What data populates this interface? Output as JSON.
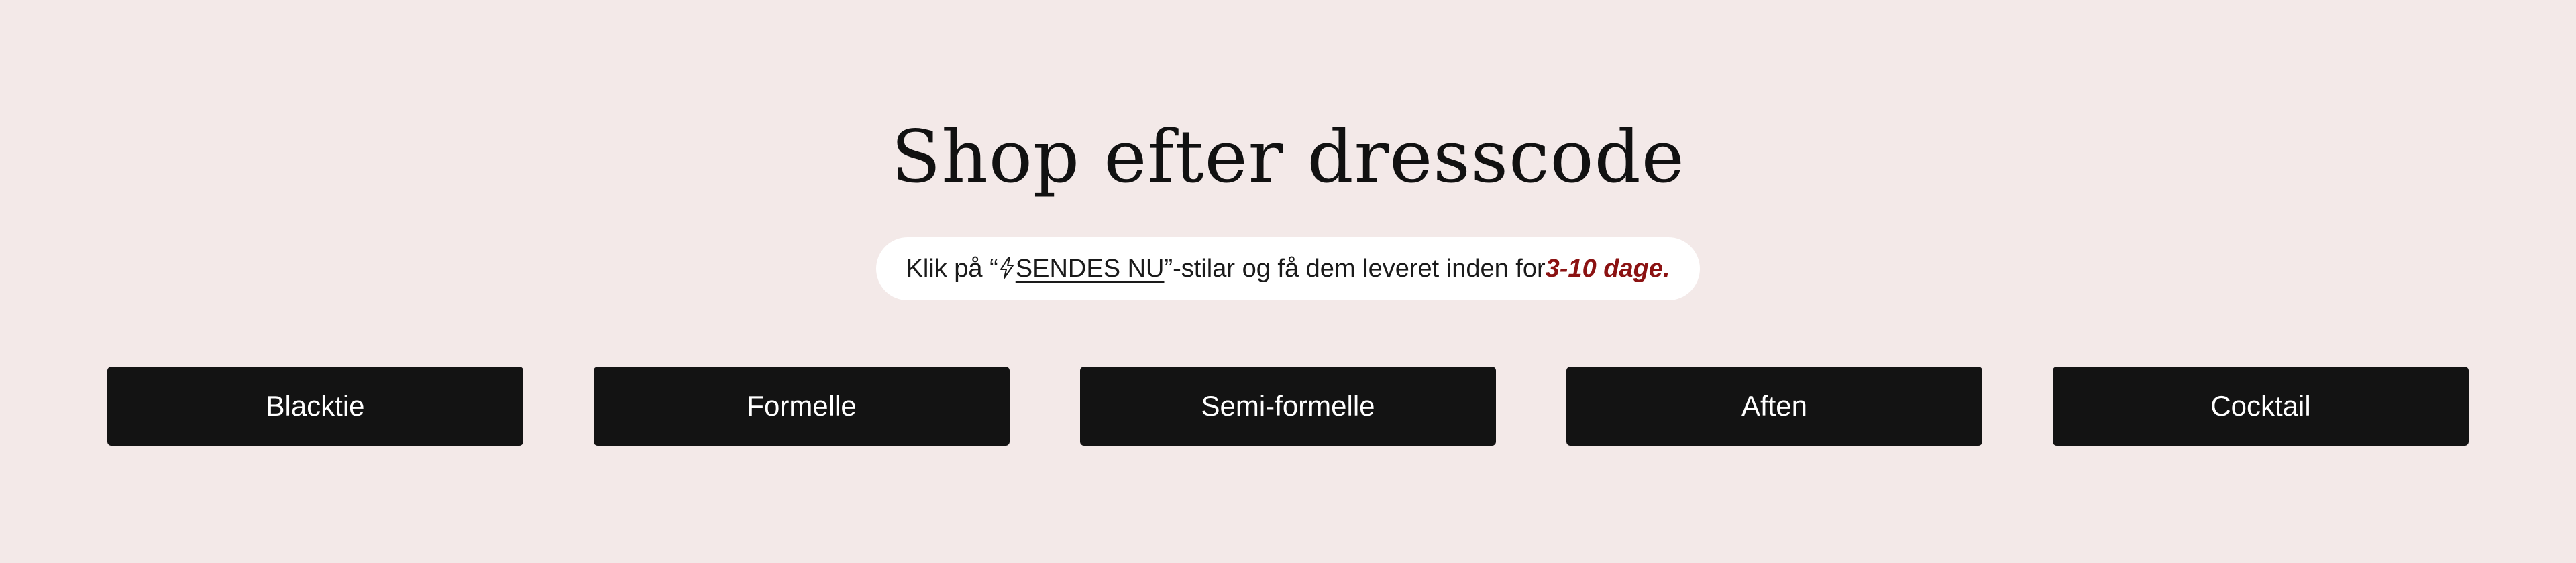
{
  "section": {
    "title": "Shop efter dresscode",
    "notice": {
      "prefix": "Klik på “ ",
      "link_text": "SENDES NU",
      "link_icon": "lightning-icon",
      "middle": "”-stilar og få dem leveret inden for ",
      "highlight": "3-10 dage",
      "suffix": ".",
      "highlight_color": "#8b1212"
    },
    "buttons": [
      {
        "label": "Blacktie"
      },
      {
        "label": "Formelle"
      },
      {
        "label": "Semi-formelle"
      },
      {
        "label": "Aften"
      },
      {
        "label": "Cocktail"
      }
    ]
  },
  "colors": {
    "background": "#f3e9e8",
    "button": "#131313",
    "button_text": "#ffffff"
  }
}
